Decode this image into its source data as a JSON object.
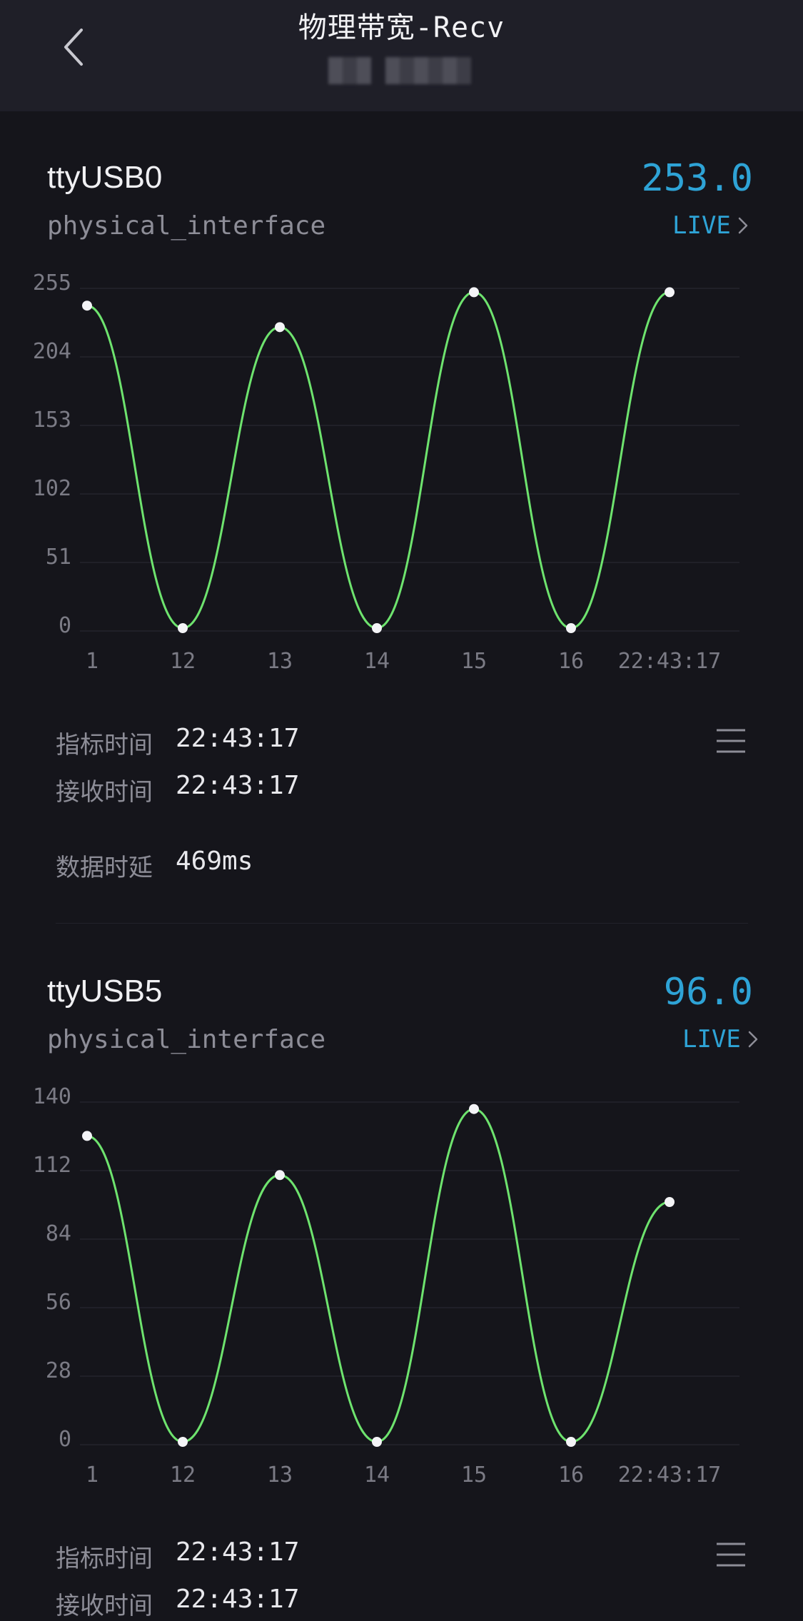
{
  "header": {
    "title": "物理带宽-Recv"
  },
  "icons": {
    "back": "chevron-left-icon",
    "live": "chevron-right-icon",
    "menu": "menu-icon"
  },
  "colors": {
    "accent": "#2ea3d6",
    "line": "#6ee36e",
    "background": "#15151b",
    "header": "#1f1f28"
  },
  "labels": {
    "metric_time": "指标时间",
    "receive_time": "接收时间",
    "data_delay": "数据时延"
  },
  "cards": [
    {
      "device": "ttyUSB0",
      "value": "253.0",
      "interface": "physical_interface",
      "live": "LIVE",
      "metric_time": "22:43:17",
      "receive_time": "22:43:17",
      "data_delay": "469ms"
    },
    {
      "device": "ttyUSB5",
      "value": "96.0",
      "interface": "physical_interface",
      "live": "LIVE",
      "metric_time": "22:43:17",
      "receive_time": "22:43:17"
    }
  ],
  "chart_data": [
    {
      "type": "line",
      "x": [
        "1",
        "12",
        "13",
        "14",
        "15",
        "16",
        "22:43:17"
      ],
      "values": [
        240,
        0,
        224,
        0,
        250,
        0,
        250
      ],
      "yticks": [
        0,
        51,
        102,
        153,
        204,
        255
      ],
      "ylim": [
        0,
        255
      ],
      "grid": true
    },
    {
      "type": "line",
      "x": [
        "1",
        "12",
        "13",
        "14",
        "15",
        "16",
        "22:43:17"
      ],
      "values": [
        125,
        0,
        109,
        0,
        136,
        0,
        98
      ],
      "yticks": [
        0,
        28,
        56,
        84,
        112,
        140
      ],
      "ylim": [
        0,
        140
      ],
      "grid": true
    }
  ]
}
